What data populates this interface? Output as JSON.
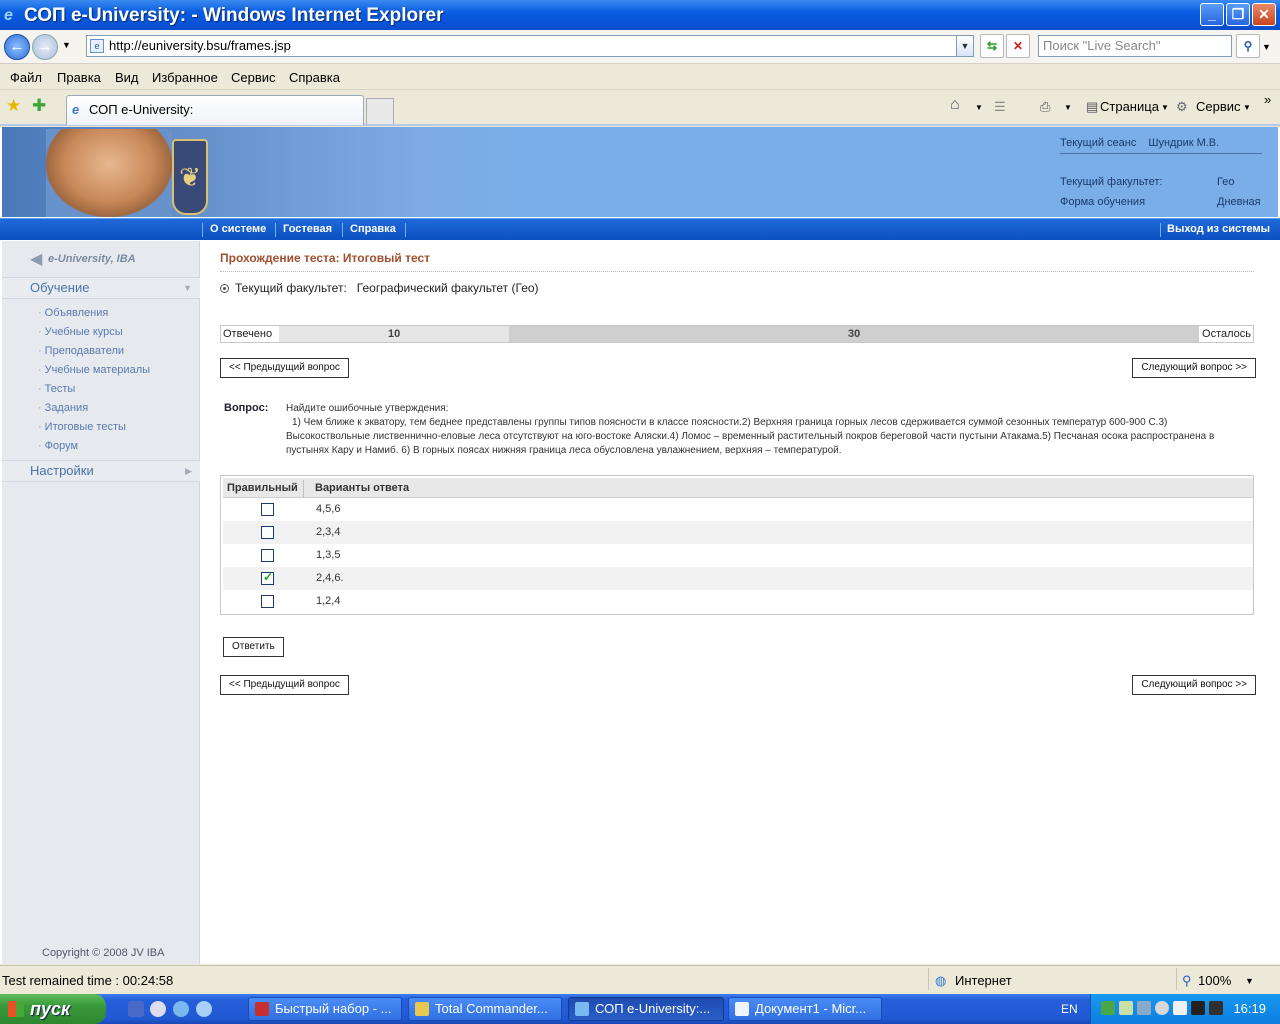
{
  "window": {
    "title": "СОП e-University:  - Windows Internet Explorer"
  },
  "addressbar": {
    "url": "http://euniversity.bsu/frames.jsp",
    "search_placeholder": "Поиск \"Live Search\""
  },
  "menu": [
    "Файл",
    "Правка",
    "Вид",
    "Избранное",
    "Сервис",
    "Справка"
  ],
  "tab": {
    "title": "СОП e-University:"
  },
  "commandbar": {
    "page": "Страница",
    "tools": "Сервис"
  },
  "header": {
    "session_label": "Текущий сеанс",
    "user": "Шундрик М.В.",
    "faculty_label": "Текущий факультет:",
    "faculty_value": "Гео",
    "form_label": "Форма обучения",
    "form_value": "Дневная"
  },
  "nav": {
    "about": "О системе",
    "guestbook": "Гостевая",
    "help": "Справка",
    "logout": "Выход из системы"
  },
  "sidebar": {
    "logo": "e-University, IBA",
    "section_learning": "Обучение",
    "items": [
      "Объявления",
      "Учебные курсы",
      "Преподаватели",
      "Учебные материалы",
      "Тесты",
      "Задания",
      "Итоговые тесты",
      "Форум"
    ],
    "section_settings": "Настройки",
    "copyright": "Copyright © 2008 JV IBA"
  },
  "main": {
    "title": "Прохождение теста: Итоговый тест",
    "faculty_label": "Текущий факультет:",
    "faculty_value": "Географический факультет (Гео)",
    "progress": {
      "answered_label": "Отвечено",
      "answered": 10,
      "remaining_label": "Осталось",
      "remaining": 30
    },
    "prev_btn": "<< Предыдущий вопрос",
    "next_btn": "Следующий вопрос >>",
    "question_label": "Вопрос:",
    "question_intro": "Найдите ошибочные утверждения:",
    "question_text": "1) Чем ближе к экватору, тем беднее представлены группы типов поясности в классе поясности.2) Верхняя граница горных лесов сдерживается суммой сезонных температур 600-900 С.3) Высокоствольные лиственнично-еловые леса отсутствуют  на юго-востоке Аляски.4) Ломос – временный растительный покров береговой части пустыни Атакама.5) Песчаная осока распространена в пустынях Кару и Намиб. 6) В горных поясах нижняя граница леса обусловлена увлажнением, верхняя – температурой.",
    "answers_header": {
      "correct": "Правильный",
      "options": "Варианты ответа"
    },
    "answers": [
      {
        "text": "4,5,6",
        "checked": false
      },
      {
        "text": "2,3,4",
        "checked": false
      },
      {
        "text": "1,3,5",
        "checked": false
      },
      {
        "text": "2,4,6.",
        "checked": true
      },
      {
        "text": "1,2,4",
        "checked": false
      }
    ],
    "submit_btn": "Ответить"
  },
  "status": {
    "timer": "Test remained time :   00:24:58",
    "zone": "Интернет",
    "zoom": "100%"
  },
  "taskbar": {
    "start": "пуск",
    "tasks": [
      "Быстрый набор - ...",
      "Total Commander...",
      "СОП e-University:...",
      "Документ1 - Micr..."
    ],
    "lang": "EN",
    "clock": "16:19"
  }
}
